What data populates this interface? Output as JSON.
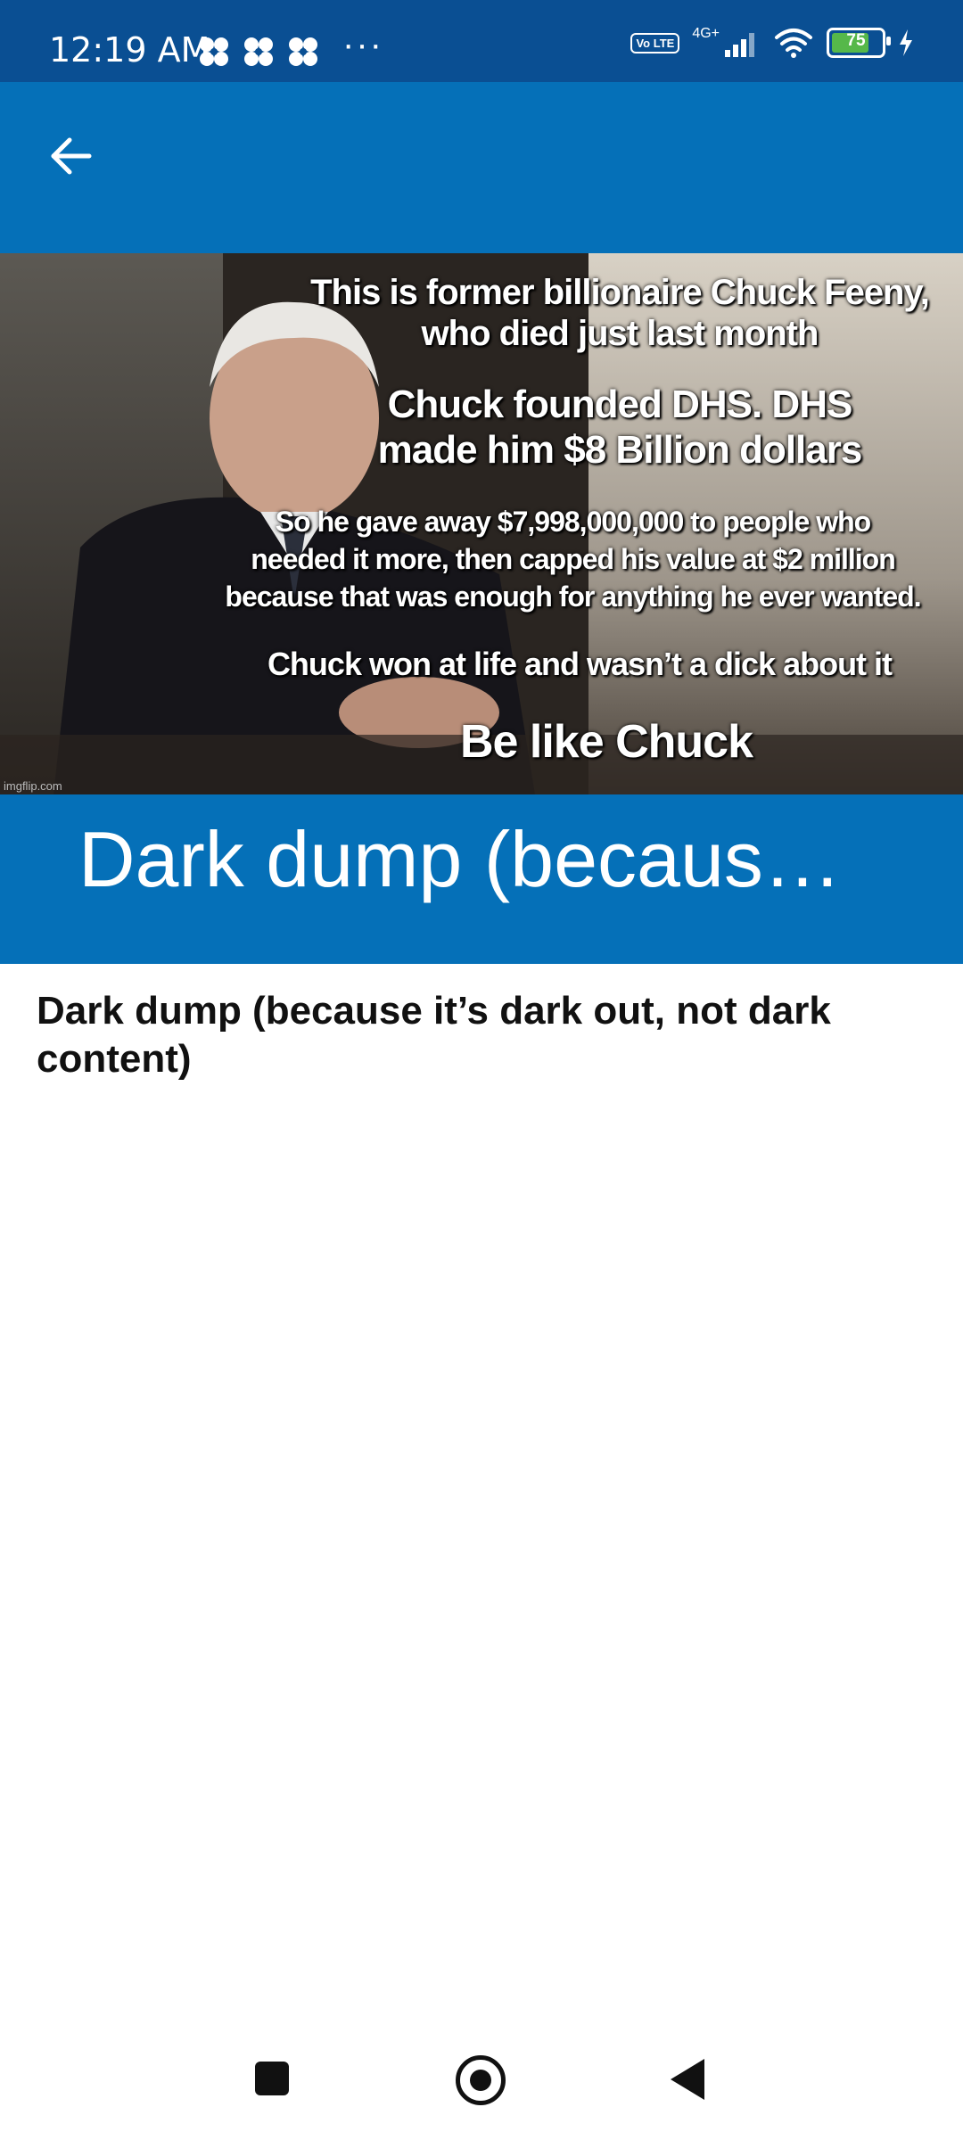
{
  "status_bar": {
    "time": "12:19 AM",
    "more": "···",
    "volte": "Vo LTE",
    "network": "4G+",
    "battery": "75",
    "battery_level": 0.75,
    "colors": {
      "background": "#0a4f93",
      "battery_fill": "#56b84a"
    }
  },
  "app_bar": {
    "back_icon": "arrow-left-icon",
    "color": "#0570b8"
  },
  "meme": {
    "lines": [
      "This is former billionaire Chuck Feeny,",
      "who died just last month",
      "Chuck founded DHS. DHS",
      "made him $8 Billion dollars",
      "So he gave away $7,998,000,000 to people who",
      "needed it more, then capped his value at $2 million",
      "because that was enough for anything he ever wanted.",
      "Chuck won at life and wasn’t a dick about it",
      "Be like Chuck"
    ],
    "watermark": "imgflip.com"
  },
  "title_band": {
    "text": "Dark dump (because it’s dark out, not dark content)"
  },
  "post": {
    "title": "Dark dump (because it’s dark out, not dark content)"
  },
  "nav_bar": {
    "icons": [
      "square-recent-apps-icon",
      "circle-home-icon",
      "triangle-back-icon"
    ]
  }
}
